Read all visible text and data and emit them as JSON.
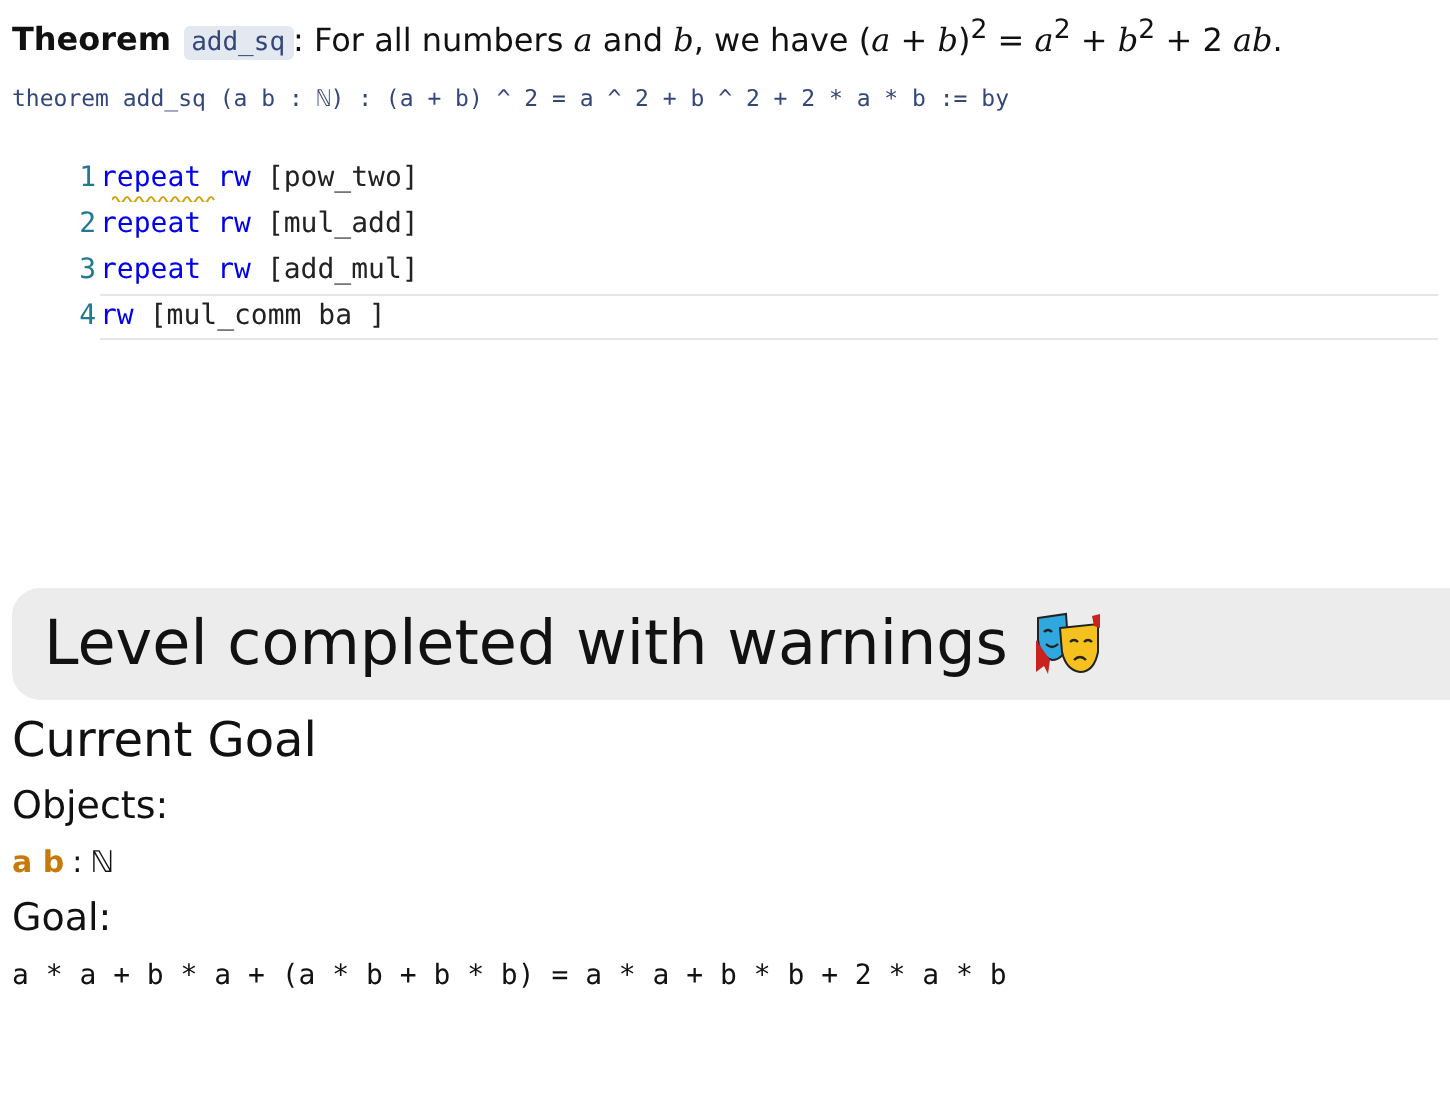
{
  "theorem": {
    "label": "Theorem",
    "name": "add_sq",
    "statement": ": For all numbers *a* and *b*, we have (*a* + *b*)$^{2}$ = *a*$^{2}$ + *b*$^{2}$ + 2 *ab*.",
    "signature": "theorem add_sq (a b : ℕ) : (a + b) ^ 2 = a ^ 2 + b ^ 2 + 2 * a * b := by"
  },
  "editor": {
    "lines": [
      {
        "number": "1",
        "keyword": "repeat",
        "tactic": "rw",
        "args": "[pow_two]",
        "warning": true,
        "selected": false
      },
      {
        "number": "2",
        "keyword": "repeat",
        "tactic": "rw",
        "args": "[mul_add]",
        "warning": false,
        "selected": false
      },
      {
        "number": "3",
        "keyword": "repeat",
        "tactic": "rw",
        "args": "[add_mul]",
        "warning": false,
        "selected": false
      },
      {
        "number": "4",
        "tactic": "rw",
        "args": "[mul_comm ba ]",
        "warning": false,
        "selected": true
      }
    ]
  },
  "banner": {
    "text": "Level completed with warnings"
  },
  "goal_panel": {
    "title": "Current Goal",
    "objects_label": "Objects:",
    "objects": {
      "names": "a b",
      "separator": ":",
      "type": "ℕ"
    },
    "goal_label": "Goal:",
    "goal": "a * a + b * a + (a * b + b * b) = a * a + b * b + 2 * a * b"
  }
}
